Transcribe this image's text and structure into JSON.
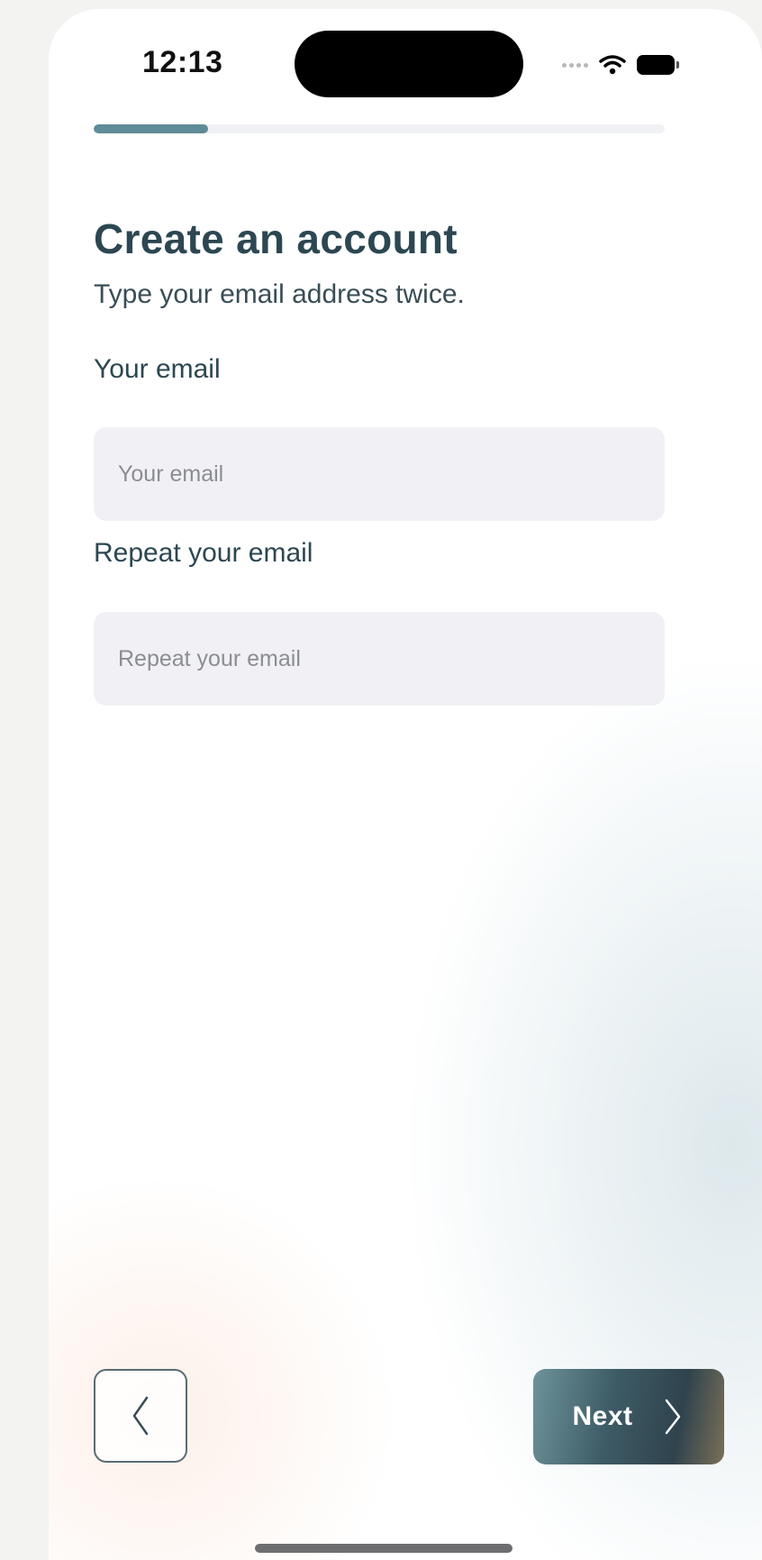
{
  "status_bar": {
    "time": "12:13",
    "icons": [
      "signal-icon",
      "wifi-icon",
      "battery-icon"
    ]
  },
  "progress": {
    "fraction": 0.2
  },
  "header": {
    "title": "Create an account",
    "subtitle": "Type your email address twice."
  },
  "form": {
    "email": {
      "label": "Your email",
      "placeholder": "Your email",
      "value": ""
    },
    "repeat_email": {
      "label": "Repeat your email",
      "placeholder": "Repeat your email",
      "value": ""
    }
  },
  "footer": {
    "back_icon": "chevron-left-icon",
    "next_label": "Next",
    "next_icon": "chevron-right-icon"
  },
  "colors": {
    "accent": "#5e8b97",
    "title": "#2c4752",
    "input_bg": "#f1f1f5"
  }
}
